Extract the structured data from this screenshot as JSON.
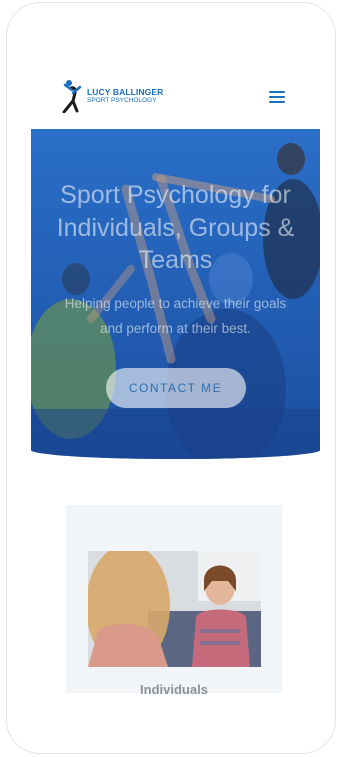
{
  "header": {
    "logo_name": "LUCY BALLINGER",
    "logo_subtitle": "SPORT PSYCHOLOGY",
    "menu_icon": "hamburger-menu-icon",
    "brand_color": "#1a6fbf"
  },
  "hero": {
    "title": "Sport Psychology for Individuals, Groups & Teams",
    "subtitle": "Helping people to achieve their goals and perform at their best.",
    "cta_label": "CONTACT ME",
    "overlay_color": "#1f5fb8"
  },
  "services": {
    "card_label": "Individuals",
    "card_bg": "#f2f5f8"
  }
}
